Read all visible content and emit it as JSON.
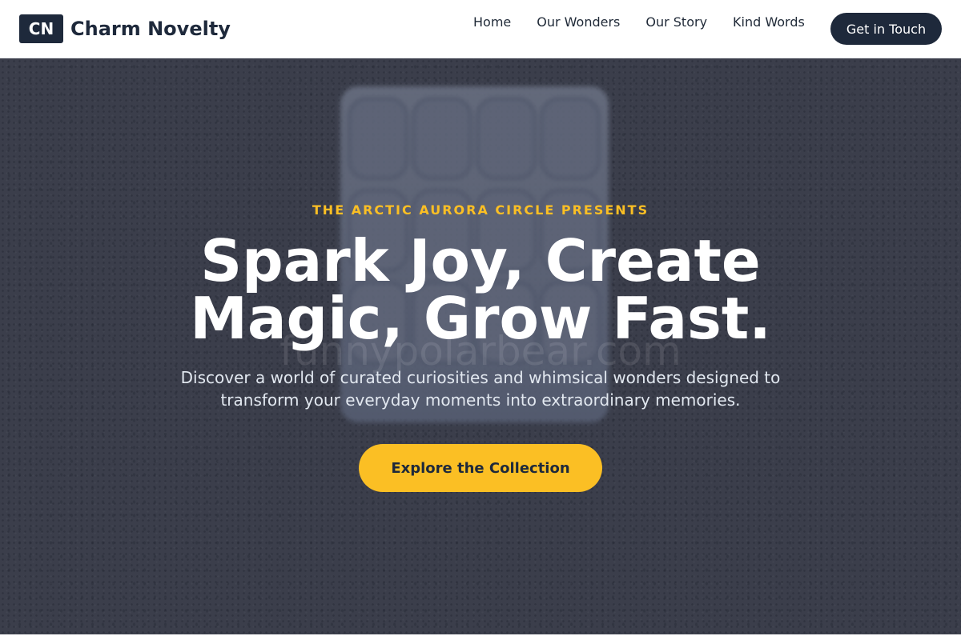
{
  "brand": {
    "mark": "CN",
    "name": "Charm Novelty"
  },
  "nav": {
    "items": [
      "Home",
      "Our Wonders",
      "Our Story",
      "Kind Words"
    ],
    "cta": "Get in Touch"
  },
  "hero": {
    "eyebrow": "THE ARCTIC AURORA CIRCLE PRESENTS",
    "headline_line1": "Spark Joy, Create",
    "headline_line2": "Magic, Grow Fast.",
    "subtext_line1": "Discover a world of curated curiosities and whimsical wonders designed to",
    "subtext_line2": "transform your everyday moments into extraordinary memories.",
    "button": "Explore the Collection",
    "watermark": "funnypolarbear.com"
  },
  "colors": {
    "brand_dark": "#1e293b",
    "accent": "#fbbf24",
    "white": "#ffffff"
  },
  "icons": {
    "hero_image": "ice-cube-tray-photo"
  }
}
